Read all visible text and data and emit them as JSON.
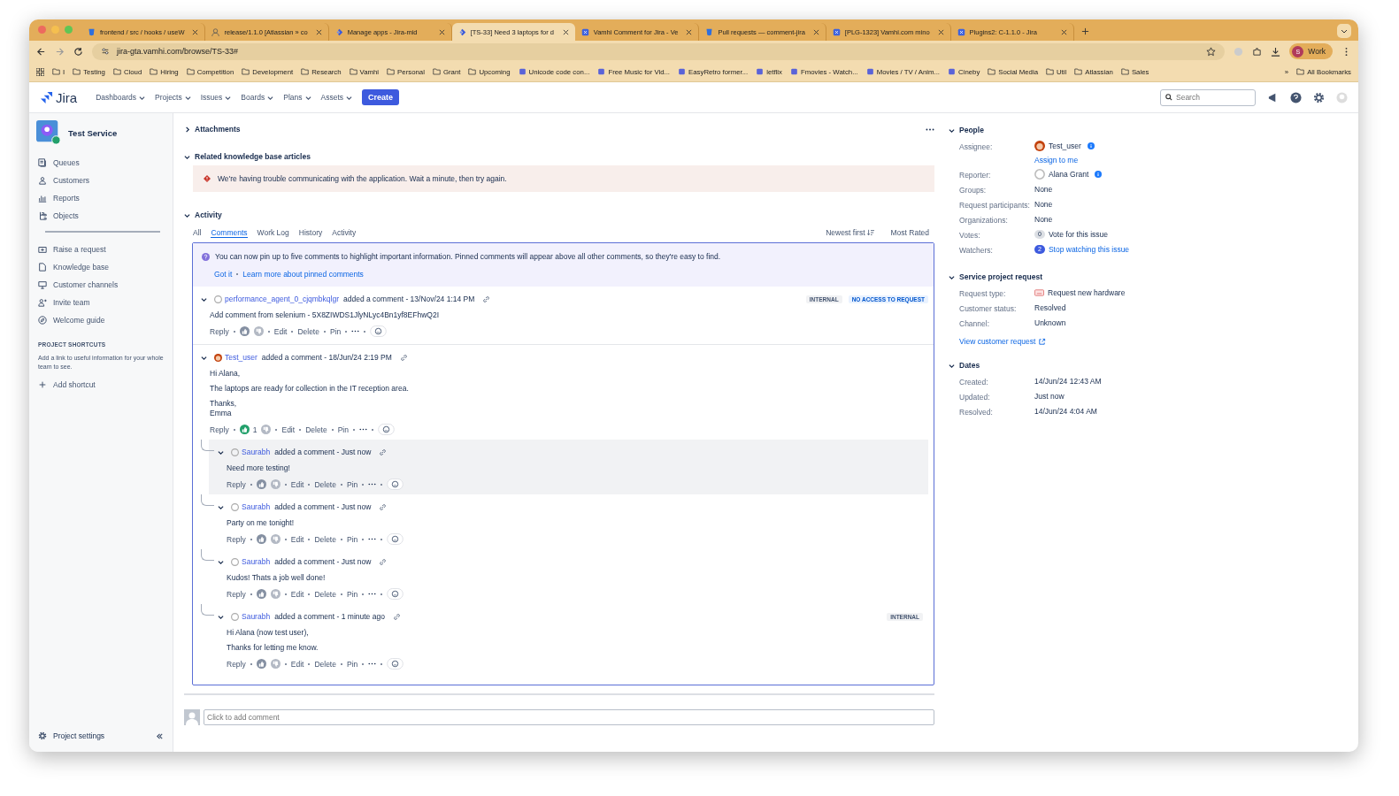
{
  "browser": {
    "tabs": [
      {
        "title": "frontend / src / hooks / useW",
        "selected": false
      },
      {
        "title": "release/1.1.0 [Atlassian » co",
        "selected": false
      },
      {
        "title": "Manage apps - Jira-mid",
        "selected": false
      },
      {
        "title": "[TS-33] Need 3 laptops for d",
        "selected": true
      },
      {
        "title": "Vamhi Comment for Jira - Ve",
        "selected": false
      },
      {
        "title": "Pull requests — comment-jira",
        "selected": false
      },
      {
        "title": "[PLG-1323] Vamhi.com mino",
        "selected": false
      },
      {
        "title": "Plugins2: C-1.1.0 - Jira",
        "selected": false
      }
    ],
    "url": "jira-gta.vamhi.com/browse/TS-33#",
    "profile_initial": "S",
    "profile": "Work",
    "bookmarks": [
      {
        "label": "I",
        "kind": "folder"
      },
      {
        "label": "Testing",
        "kind": "folder"
      },
      {
        "label": "Cloud",
        "kind": "folder"
      },
      {
        "label": "Hiring",
        "kind": "folder"
      },
      {
        "label": "Competition",
        "kind": "folder"
      },
      {
        "label": "Development",
        "kind": "folder"
      },
      {
        "label": "Research",
        "kind": "folder"
      },
      {
        "label": "Vamhi",
        "kind": "folder"
      },
      {
        "label": "Personal",
        "kind": "folder"
      },
      {
        "label": "Grant",
        "kind": "folder"
      },
      {
        "label": "Upcoming",
        "kind": "folder"
      },
      {
        "label": "Unicode code con...",
        "kind": "site"
      },
      {
        "label": "Free Music for Vid...",
        "kind": "site"
      },
      {
        "label": "EasyRetro former...",
        "kind": "site"
      },
      {
        "label": "letflix",
        "kind": "site"
      },
      {
        "label": "Fmovies - Watch...",
        "kind": "site"
      },
      {
        "label": "Movies / TV / Anim...",
        "kind": "site"
      },
      {
        "label": "Cineby",
        "kind": "site"
      },
      {
        "label": "Social Media",
        "kind": "folder"
      },
      {
        "label": "Util",
        "kind": "folder"
      },
      {
        "label": "Atlassian",
        "kind": "folder"
      },
      {
        "label": "Sales",
        "kind": "folder"
      }
    ],
    "more_bookmarks": "»",
    "all_bookmarks": "All Bookmarks"
  },
  "jira": {
    "logo": "Jira",
    "nav": [
      "Dashboards",
      "Projects",
      "Issues",
      "Boards",
      "Plans",
      "Assets"
    ],
    "create": "Create",
    "search_placeholder": "Search"
  },
  "sidebar": {
    "project": "Test Service",
    "items": [
      "Queues",
      "Customers",
      "Reports",
      "Objects"
    ],
    "items_2": [
      "Raise a request",
      "Knowledge base",
      "Customer channels",
      "Invite team",
      "Welcome guide"
    ],
    "shortcuts_heading": "PROJECT SHORTCUTS",
    "shortcuts_text": "Add a link to useful information for your whole team to see.",
    "add_shortcut": "Add shortcut",
    "settings": "Project settings"
  },
  "main": {
    "attachments": "Attachments",
    "kb_heading": "Related knowledge base articles",
    "kb_error": "We're having trouble communicating with the application. Wait a minute, then try again.",
    "activity_heading": "Activity",
    "tabs": [
      {
        "label": "All",
        "selected": false
      },
      {
        "label": "Comments",
        "selected": true
      },
      {
        "label": "Work Log",
        "selected": false
      },
      {
        "label": "History",
        "selected": false
      },
      {
        "label": "Activity",
        "selected": false
      }
    ],
    "sort": "Newest first",
    "most_rated": "Most Rated",
    "pin_notice": "You can now pin up to five comments to highlight important information. Pinned comments will appear above all other comments, so they're easy to find.",
    "got_it": "Got it",
    "learn_more": "Learn more about pinned comments",
    "comments": [
      {
        "author": "performance_agent_0_cjqmbkqlgr",
        "kind": "no_photo",
        "meta": "added a comment - 13/Nov/24 1:14 PM",
        "badges": [
          {
            "label": "INTERNAL",
            "kind": "internal"
          },
          {
            "label": "NO ACCESS TO REQUEST",
            "kind": "access"
          }
        ],
        "body": [
          "Add comment from selenium - 5X8ZIWDS1JlyNLyc4Bn1yf8EFhwQ2I"
        ],
        "reply": "Reply",
        "liked": false,
        "actions": [
          "Edit",
          "Delete",
          "Pin"
        ],
        "highlighted": false
      },
      {
        "author": "Test_user",
        "kind": "photo",
        "meta": "added a comment - 18/Jun/24 2:19 PM",
        "body": [
          "Hi Alana,",
          "The laptops are ready for collection in the IT reception area.",
          "Thanks,\nEmma"
        ],
        "reply": "Reply",
        "liked": true,
        "like_count": "1",
        "actions": [
          "Edit",
          "Delete",
          "Pin"
        ],
        "highlighted": false,
        "children": [
          {
            "author": "Saurabh",
            "kind": "no_photo",
            "meta": "added a comment - Just now",
            "body": [
              "Need more testing!"
            ],
            "reply": "Reply",
            "liked": false,
            "actions": [
              "Edit",
              "Delete",
              "Pin"
            ],
            "highlighted": true
          },
          {
            "author": "Saurabh",
            "kind": "no_photo",
            "meta": "added a comment - Just now",
            "body": [
              "Party on me tonight!"
            ],
            "reply": "Reply",
            "liked": false,
            "actions": [
              "Edit",
              "Delete",
              "Pin"
            ],
            "highlighted": false
          },
          {
            "author": "Saurabh",
            "kind": "no_photo",
            "meta": "added a comment - Just now",
            "body": [
              "Kudos! Thats a job well done!"
            ],
            "reply": "Reply",
            "liked": false,
            "actions": [
              "Edit",
              "Delete",
              "Pin"
            ],
            "highlighted": false
          },
          {
            "author": "Saurabh",
            "kind": "no_photo",
            "meta": "added a comment - 1 minute ago",
            "badges": [
              {
                "label": "INTERNAL",
                "kind": "internal"
              }
            ],
            "body": [
              "Hi Alana (now test user),",
              "Thanks for letting me know."
            ],
            "reply": "Reply",
            "liked": false,
            "actions": [
              "Edit",
              "Delete",
              "Pin"
            ],
            "highlighted": false
          }
        ]
      }
    ],
    "add_comment_placeholder": "Click to add comment"
  },
  "details": [
    {
      "heading": "People",
      "fields": [
        {
          "label": "Assignee:",
          "kind": "user_photo",
          "value": "Test_user",
          "link": "Assign to me"
        },
        {
          "label": "Reporter:",
          "kind": "user",
          "value": "Alana Grant"
        },
        {
          "label": "Groups:",
          "kind": "text",
          "value": "None"
        },
        {
          "label": "Request participants:",
          "kind": "text",
          "value": "None"
        },
        {
          "label": "Organizations:",
          "kind": "text",
          "value": "None"
        },
        {
          "label": "Votes:",
          "kind": "vote",
          "count": "0",
          "value": "Vote for this issue"
        },
        {
          "label": "Watchers:",
          "kind": "watch",
          "count": "2",
          "value": "Stop watching this issue"
        }
      ]
    },
    {
      "heading": "Service project request",
      "fields": [
        {
          "label": "Request type:",
          "kind": "request",
          "value": "Request new hardware"
        },
        {
          "label": "Customer status:",
          "kind": "text",
          "value": "Resolved"
        },
        {
          "label": "Channel:",
          "kind": "text",
          "value": "Unknown"
        }
      ],
      "link": "View customer request"
    },
    {
      "heading": "Dates",
      "fields": [
        {
          "label": "Created:",
          "kind": "text",
          "value": "14/Jun/24 12:43 AM"
        },
        {
          "label": "Updated:",
          "kind": "text",
          "value": "Just now"
        },
        {
          "label": "Resolved:",
          "kind": "text",
          "value": "14/Jun/24 4:04 AM"
        }
      ]
    }
  ]
}
